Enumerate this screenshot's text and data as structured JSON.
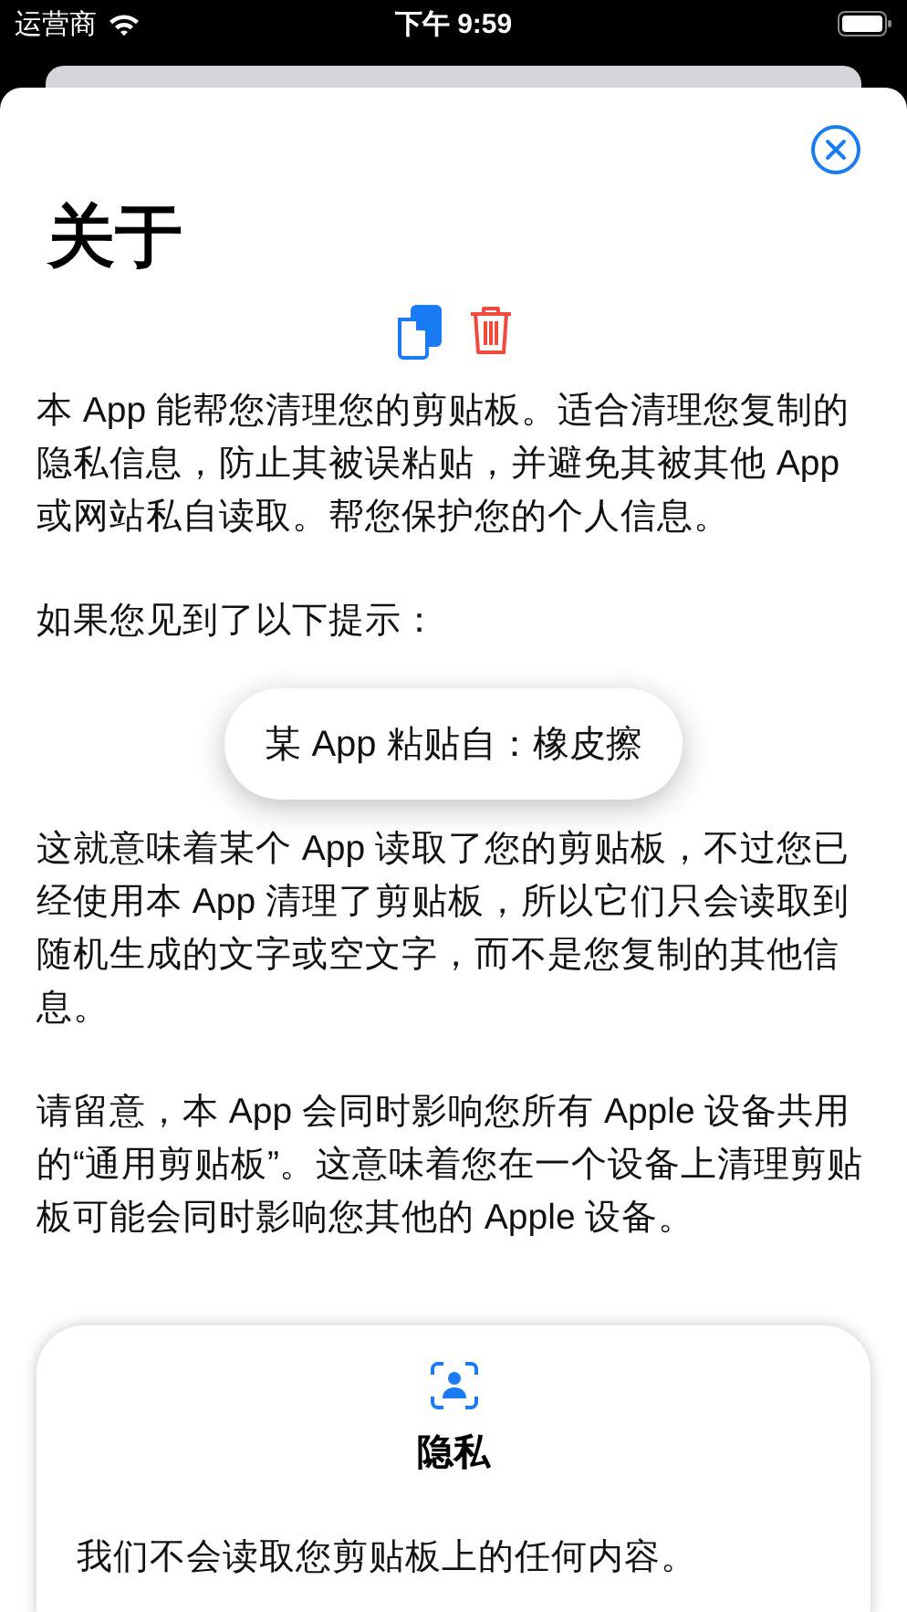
{
  "status_bar": {
    "carrier": "运营商",
    "time": "下午 9:59"
  },
  "sheet": {
    "title": "关于",
    "paragraphs": [
      "本 App 能帮您清理您的剪贴板。适合清理您复制的隐私信息，防止其被误粘贴，并避免其被其他 App 或网站私自读取。帮您保护您的个人信息。",
      "如果您见到了以下提示："
    ],
    "banner": "某 App 粘贴自：橡皮擦",
    "paragraphs_after": [
      "这就意味着某个 App 读取了您的剪贴板，不过您已经使用本 App 清理了剪贴板，所以它们只会读取到随机生成的文字或空文字，而不是您复制的其他信息。",
      "请留意，本 App 会同时影响您所有 Apple 设备共用的“通用剪贴板”。这意味着您在一个设备上清理剪贴板可能会同时影响您其他的 Apple 设备。"
    ],
    "card": {
      "title": "隐私",
      "text": "我们不会读取您剪贴板上的任何内容。"
    }
  }
}
